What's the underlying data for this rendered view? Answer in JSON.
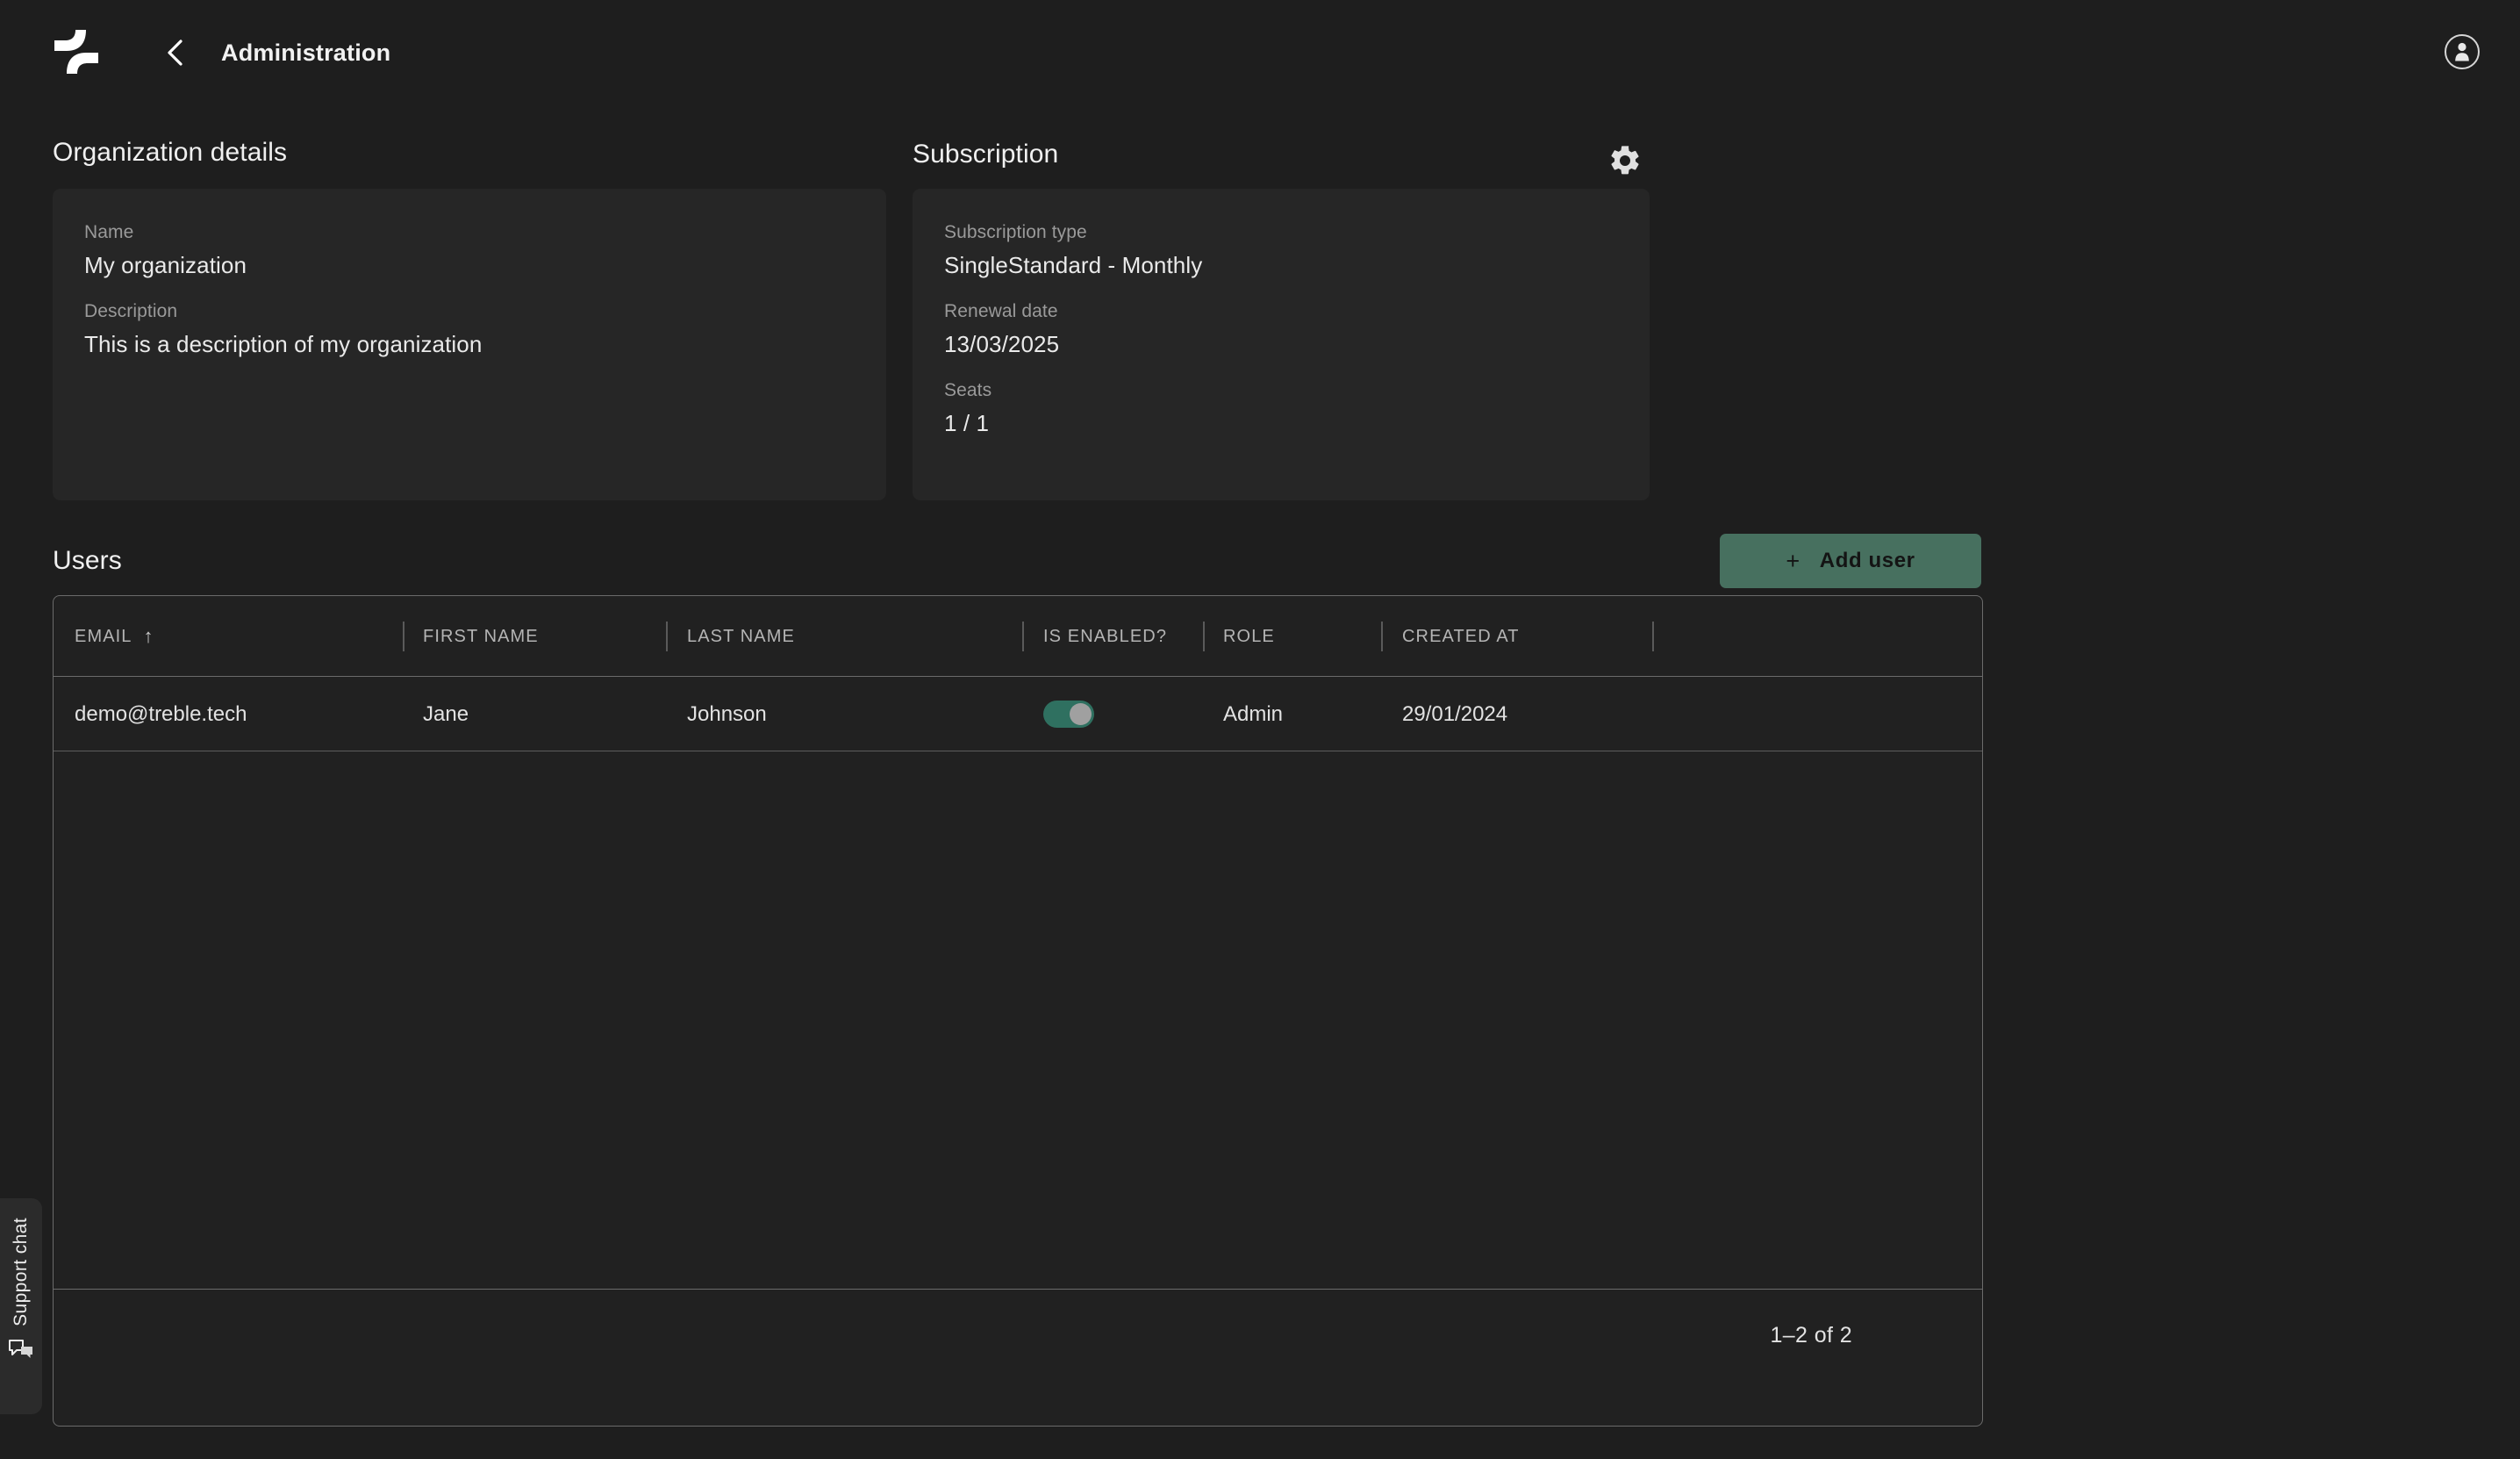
{
  "header": {
    "logo_icon": "treble-logo-icon",
    "back_icon": "chevron-left-icon",
    "title": "Administration",
    "account_icon": "account-circle-icon"
  },
  "organization": {
    "heading": "Organization details",
    "fields": [
      {
        "label": "Name",
        "value": "My organization"
      },
      {
        "label": "Description",
        "value": "This is a description of my organization"
      }
    ]
  },
  "subscription": {
    "heading": "Subscription",
    "settings_icon": "gear-icon",
    "fields": [
      {
        "label": "Subscription type",
        "value": "SingleStandard - Monthly"
      },
      {
        "label": "Renewal date",
        "value": "13/03/2025"
      },
      {
        "label": "Seats",
        "value": "1 / 1"
      }
    ]
  },
  "users": {
    "heading": "Users",
    "add_button": {
      "label": "Add user",
      "plus": "+",
      "color": "#47705f"
    },
    "columns": [
      {
        "label": "EMAIL",
        "sorted": true,
        "sort_arrow": "↑"
      },
      {
        "label": "FIRST NAME",
        "sorted": false,
        "sort_arrow": ""
      },
      {
        "label": "LAST NAME",
        "sorted": false,
        "sort_arrow": ""
      },
      {
        "label": "IS ENABLED?",
        "sorted": false,
        "sort_arrow": ""
      },
      {
        "label": "ROLE",
        "sorted": false,
        "sort_arrow": ""
      },
      {
        "label": "CREATED AT",
        "sorted": false,
        "sort_arrow": ""
      },
      {
        "label": "",
        "sorted": false,
        "sort_arrow": ""
      }
    ],
    "rows": [
      {
        "email": "demo@treble.tech",
        "first_name": "Jane",
        "last_name": "Johnson",
        "is_enabled": true,
        "role": "Admin",
        "created_at": "29/01/2024"
      }
    ],
    "pagination": "1–2 of 2",
    "toggle_on_color": "#2f7060",
    "toggle_knob_color": "#a0a0a0"
  },
  "support_chat": {
    "label": "Support chat",
    "icon": "chat-bubbles-icon"
  }
}
